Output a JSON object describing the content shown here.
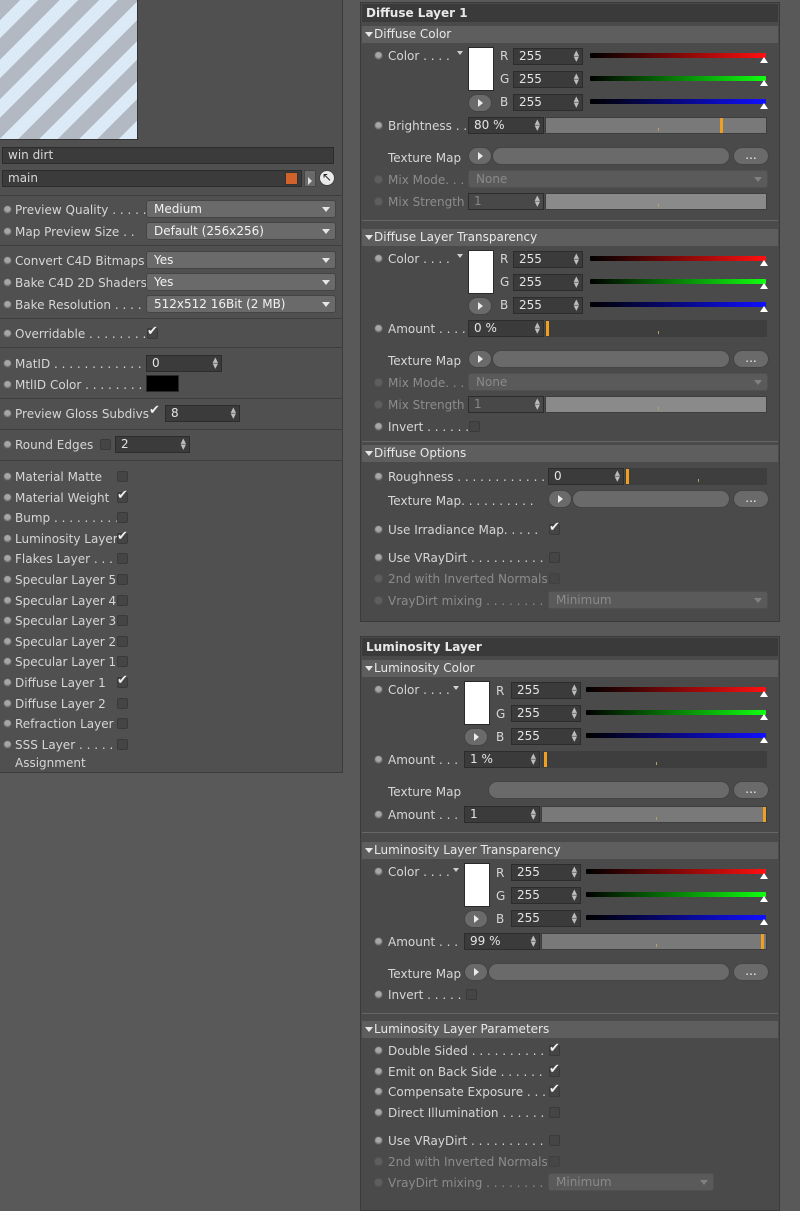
{
  "left": {
    "name_field": "win dirt",
    "group_field": "main",
    "preview_quality": {
      "label": "Preview Quality . . . . .",
      "value": "Medium"
    },
    "map_preview_size": {
      "label": "Map Preview Size . .",
      "value": "Default (256x256)"
    },
    "convert_bitmaps": {
      "label": "Convert C4D Bitmaps",
      "value": "Yes"
    },
    "bake_shaders": {
      "label": "Bake C4D 2D Shaders",
      "value": "Yes"
    },
    "bake_resolution": {
      "label": "Bake Resolution . . . .",
      "value": "512x512  16Bit  (2 MB)"
    },
    "overridable": "Overridable . . . . . . . .",
    "matid": {
      "label": "MatID . . . . . . . . . . . . .",
      "value": "0"
    },
    "mtlid_color": "MtlID Color . . . . . . . .",
    "gloss_subdivs": {
      "label": "Preview Gloss Subdivs",
      "value": "8"
    },
    "round_edges": {
      "label": "Round Edges",
      "value": "2"
    },
    "layers": [
      {
        "label": "Material Matte",
        "checked": false
      },
      {
        "label": "Material Weight",
        "checked": true
      },
      {
        "label": "Bump . . . . . . . . .",
        "checked": false
      },
      {
        "label": "Luminosity Layer",
        "checked": true
      },
      {
        "label": "Flakes Layer . . . .",
        "checked": false
      },
      {
        "label": "Specular Layer 5",
        "checked": false
      },
      {
        "label": "Specular Layer 4",
        "checked": false
      },
      {
        "label": "Specular Layer 3",
        "checked": false
      },
      {
        "label": "Specular Layer 2",
        "checked": false
      },
      {
        "label": "Specular Layer 1",
        "checked": false
      },
      {
        "label": "Diffuse Layer 1",
        "checked": true
      },
      {
        "label": "Diffuse Layer 2",
        "checked": false
      },
      {
        "label": "Refraction Layer",
        "checked": false
      },
      {
        "label": "SSS Layer . . . . . .",
        "checked": false
      }
    ],
    "assignment": "Assignment"
  },
  "diffuse": {
    "title": "Diffuse Layer 1",
    "color_head": "Diffuse Color",
    "color_label": "Color . . . .",
    "r": "255",
    "g": "255",
    "b": "255",
    "brightness_label": "Brightness . .",
    "brightness": "80 %",
    "brightness_pct": 0.8,
    "texture_label": "Texture Map",
    "mixmode_label": "Mix Mode. . . .",
    "mixmode": "None",
    "mixstrength_label": "Mix Strength",
    "mixstrength": "1",
    "trans_head": "Diffuse Layer Transparency",
    "trans_color_label": "Color . . . .",
    "tr": "255",
    "tg": "255",
    "tb": "255",
    "amount_label": "Amount . . . .",
    "amount": "0 %",
    "amount_pct": 0,
    "texture2_label": "Texture Map",
    "mixmode2_label": "Mix Mode. . . .",
    "mixmode2": "None",
    "mixstrength2_label": "Mix Strength",
    "mixstrength2": "1",
    "invert_label": "Invert . . . . . .",
    "options_head": "Diffuse Options",
    "roughness_label": "Roughness . . . . . . . . . . . .",
    "roughness": "0",
    "texture3_label": "Texture Map. . . . . . . . . .",
    "irradiance_label": "Use Irradiance Map. . . . .",
    "vraydirt_label": "Use VRayDirt . . . . . . . . . .",
    "inverted_label": "2nd with Inverted Normals",
    "mixing_label": "VrayDirt mixing . . . . . . . . .",
    "mixing": "Minimum"
  },
  "lum": {
    "title": "Luminosity Layer",
    "color_head": "Luminosity Color",
    "color_label": "Color . . . .",
    "r": "255",
    "g": "255",
    "b": "255",
    "amount_label": "Amount . . .",
    "amount": "1 %",
    "amount_pct": 0.01,
    "texture_label": "Texture Map",
    "amount2_label": "Amount . . .",
    "amount2": "1",
    "amount2_pct": 1,
    "trans_head": "Luminosity Layer Transparency",
    "trans_color_label": "Color . . . .",
    "tr": "255",
    "tg": "255",
    "tb": "255",
    "tamount_label": "Amount . . .",
    "tamount": "99 %",
    "tamount_pct": 0.99,
    "texture2_label": "Texture Map",
    "invert_label": "Invert . . . . .",
    "params_head": "Luminosity Layer Parameters",
    "double_sided": "Double Sided . . . . . . . . . .",
    "emit_back": "Emit on Back Side . . . . . .",
    "compensate": "Compensate Exposure . . .",
    "direct": "Direct Illumination . . . . . .",
    "vraydirt_label": "Use VRayDirt . . . . . . . . . .",
    "inverted_label": "2nd with Inverted Normals",
    "mixing_label": "VrayDirt mixing . . . . . . . . .",
    "mixing": "Minimum"
  },
  "colors": {
    "accent": "#f0a020",
    "swatch_orange": "#d0622a"
  }
}
